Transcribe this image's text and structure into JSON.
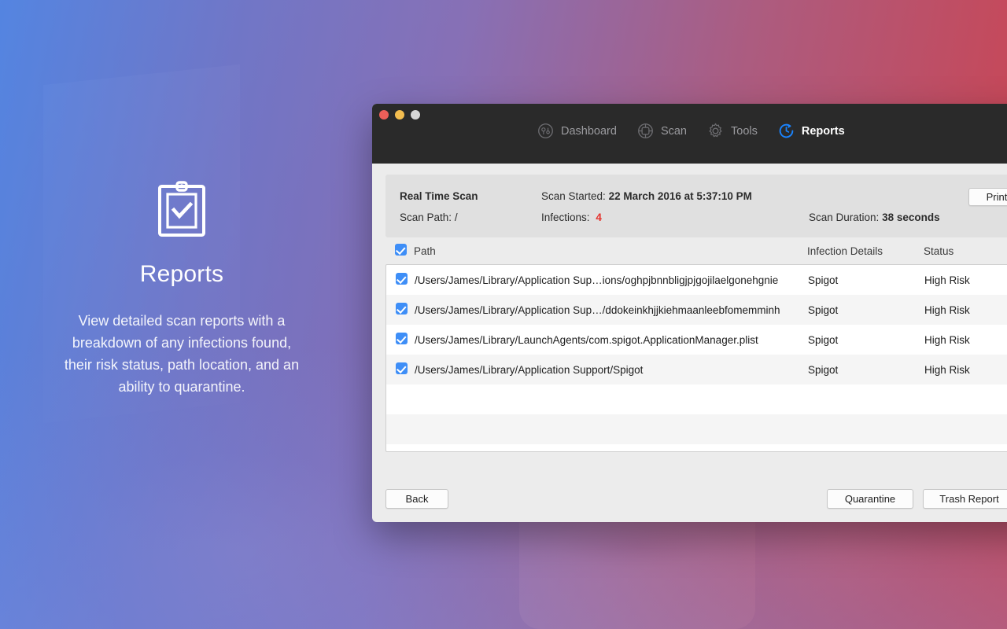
{
  "background": {
    "gradient_start": "#4882e8",
    "gradient_mid": "#8a68b2",
    "gradient_end": "#e23434"
  },
  "promo": {
    "icon": "clipboard-check-icon",
    "title": "Reports",
    "description": "View detailed scan reports with a breakdown of any infections found, their risk status, path location, and an ability to quarantine."
  },
  "window": {
    "traffic_lights": [
      "close-red",
      "minimize-yellow",
      "zoom-gray"
    ],
    "nav": [
      {
        "label": "Dashboard",
        "icon": "dashboard-icon",
        "active": false
      },
      {
        "label": "Scan",
        "icon": "scan-target-icon",
        "active": false
      },
      {
        "label": "Tools",
        "icon": "gear-icon",
        "active": false
      },
      {
        "label": "Reports",
        "icon": "history-clock-icon",
        "active": true
      }
    ],
    "accent_color": "#1a84ff"
  },
  "info": {
    "scan_type": "Real Time Scan",
    "scan_started_label": "Scan Started:",
    "scan_started_value": "22 March 2016 at 5:37:10 PM",
    "scan_path_label": "Scan Path:",
    "scan_path_value": "/",
    "infections_label": "Infections:",
    "infections_value": "4",
    "infections_color": "#e5322d",
    "scan_duration_label": "Scan Duration:",
    "scan_duration_value": "38 seconds",
    "print_label": "Print"
  },
  "table": {
    "select_all_checked": true,
    "headers": {
      "path": "Path",
      "infection_details": "Infection Details",
      "status": "Status"
    },
    "rows": [
      {
        "checked": true,
        "path": "/Users/James/Library/Application Sup…ions/oghpjbnnbligjpjgojilaelgonehgnie",
        "infection": "Spigot",
        "status": "High Risk"
      },
      {
        "checked": true,
        "path": "/Users/James/Library/Application Sup…/ddokeinkhjjkiehmaanleebfomemminh",
        "infection": "Spigot",
        "status": "High Risk"
      },
      {
        "checked": true,
        "path": "/Users/James/Library/LaunchAgents/com.spigot.ApplicationManager.plist",
        "infection": "Spigot",
        "status": "High Risk"
      },
      {
        "checked": true,
        "path": "/Users/James/Library/Application Support/Spigot",
        "infection": "Spigot",
        "status": "High Risk"
      }
    ],
    "empty_row_count": 2
  },
  "footer": {
    "back_label": "Back",
    "quarantine_label": "Quarantine",
    "trash_report_label": "Trash Report"
  }
}
